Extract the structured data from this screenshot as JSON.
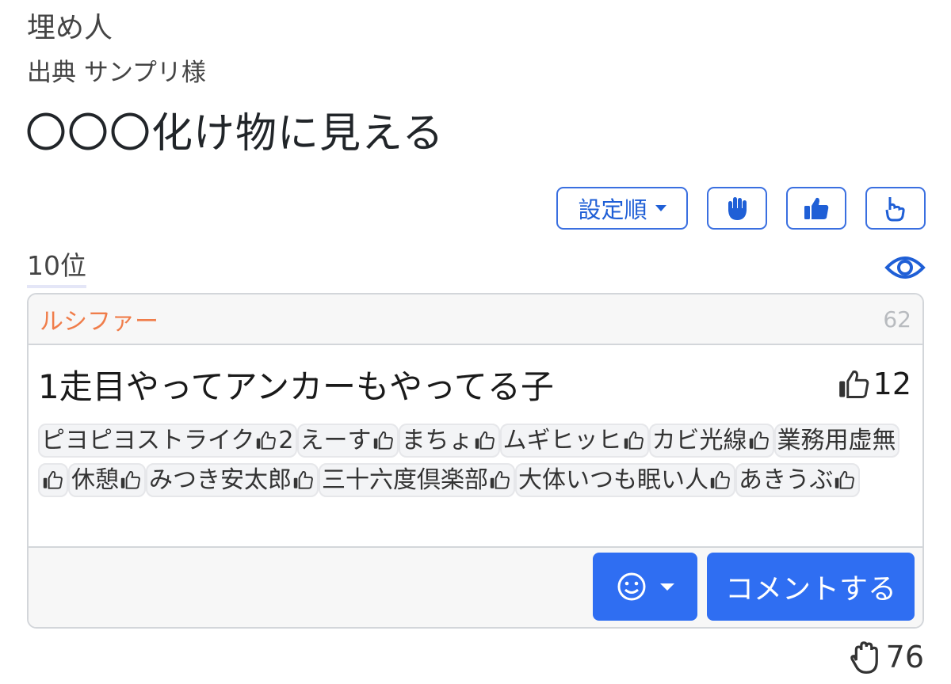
{
  "header": {
    "genre": "埋め人",
    "source": "出典 サンプリ様",
    "odai": "〇〇〇化け物に見える"
  },
  "toolbar": {
    "sort_label": "設定順",
    "icons": [
      "hand-icon",
      "thumbs-up-icon",
      "pointing-hand-icon"
    ]
  },
  "rank": {
    "label": "10位"
  },
  "answer_card": {
    "author": "ルシファー",
    "points": "62",
    "answer": "1走目やってアンカーもやってる子",
    "likes": "12",
    "voters": [
      {
        "name": "ピヨピヨストライク",
        "count": "2"
      },
      {
        "name": "えーす",
        "count": ""
      },
      {
        "name": "まちょ",
        "count": ""
      },
      {
        "name": "ムギヒッヒ",
        "count": ""
      },
      {
        "name": "カビ光線",
        "count": ""
      },
      {
        "name": "業務用虚無",
        "count": ""
      },
      {
        "name": "休憩",
        "count": ""
      },
      {
        "name": "みつき安太郎",
        "count": ""
      },
      {
        "name": "三十六度倶楽部",
        "count": ""
      },
      {
        "name": "大体いつも眠い人",
        "count": ""
      },
      {
        "name": "あきうぶ",
        "count": ""
      }
    ],
    "comment_label": "コメントする"
  },
  "footer": {
    "hands": "76"
  },
  "colors": {
    "accent": "#2f6ef2",
    "author": "#f07d4a",
    "outline": "#3a6fe0"
  }
}
